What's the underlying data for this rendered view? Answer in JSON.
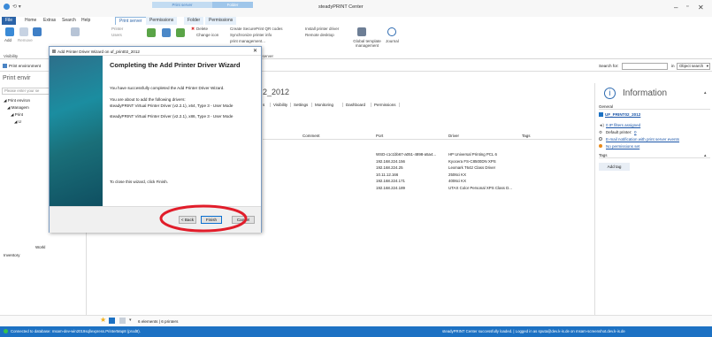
{
  "app": {
    "title": "steadyPRINT Center"
  },
  "context_tabs": {
    "print_server": "Print server",
    "folder": "Folder"
  },
  "tabs": [
    "File",
    "Home",
    "Extras",
    "Search",
    "Help",
    "Print server",
    "Permissions",
    "Folder",
    "Permissions"
  ],
  "ribbon": {
    "add": "Add",
    "remove": "Remove",
    "visibility": "Visibility",
    "printer": "Printer",
    "users": "Users",
    "delete": "Delete",
    "change_icon": "Change icon",
    "create_codes": "Create SecurePrint QR codes",
    "sync_info": "Synchronize printer info",
    "install_driver": "Install printer driver",
    "remote_desktop": "Remote desktop",
    "print_mgmt": "print management...",
    "group_label": "Print server",
    "global_template": "Global template management",
    "journal": "Journal"
  },
  "address": {
    "path": "Print environment",
    "search_for": "Search for:",
    "in_label": "in",
    "scope": "Object search"
  },
  "nav": {
    "title": "Print envir",
    "search_placeholder": "Please enter your se",
    "items": [
      "Print environ",
      "Managem",
      "Print",
      "U",
      "Workl",
      "Inventory"
    ]
  },
  "main": {
    "heading": "2_2012",
    "tabs": [
      "s",
      "Visibility",
      "Settings",
      "Monitoring",
      "Dashboard",
      "Permissions"
    ],
    "columns": [
      "Comment",
      "Port",
      "Driver",
      "Tags"
    ],
    "rows": [
      {
        "port": "WSD-c1c1bb67-a051-4898-a5a4...",
        "driver": "HP Universal Printing PCL 6"
      },
      {
        "port": "192.168.224.156",
        "driver": "Kyocera FS-C8500DN XPS"
      },
      {
        "port": "192.168.224.25",
        "driver": "Lexmark T642 Class Driver"
      },
      {
        "port": "10.11.12.166",
        "driver": "2506ci KX"
      },
      {
        "port": "192.168.224.171",
        "driver": "4006ci KX"
      },
      {
        "port": "192.168.224.189",
        "driver": "UTAX Color Personal XPS Class D..."
      }
    ],
    "footer": "6 elements | 6 printers"
  },
  "info": {
    "title": "Information",
    "general": "General",
    "name": "UF_PRINT02_2012",
    "ip_filters": "0 IP filters assigned",
    "default_printer_label": "Default printer:",
    "default_printer_value": "0",
    "email_notif": "E-mail notification with print server events",
    "no_permissions": "No permissions set",
    "tags": "Tags",
    "add_tag": "Add tag"
  },
  "dialog": {
    "title": "Add Printer Driver Wizard on uf_print02_2012",
    "heading": "Completing the Add Printer Driver Wizard",
    "line1": "You have successfully completed the Add Printer Driver Wizard.",
    "line2": "You are about to add the following drivers:",
    "driver1": "steadyPRINT Virtual Printer Driver (v2.2.1), x64, Type 3 - User Mode",
    "driver2": "steadyPRINT Virtual Printer Driver (v2.2.1), x86, Type 3 - User Mode",
    "close_hint": "To close this wizard, click Finish.",
    "back": "< Back",
    "finish": "Finish",
    "cancel": "Cancel"
  },
  "status": {
    "left": "Connected to database: msam-dev-win2019sql\\express.PrinterMap8 (prod8).",
    "right": "steadyPRINT Center successfully loaded. | Logged in as sputa@dev.k-is.de on msam-screenshot.dev.k-is.de"
  },
  "colors": {
    "accent": "#1c71c3",
    "highlight": "#e11d2a",
    "file_tab": "#2c64a8"
  }
}
